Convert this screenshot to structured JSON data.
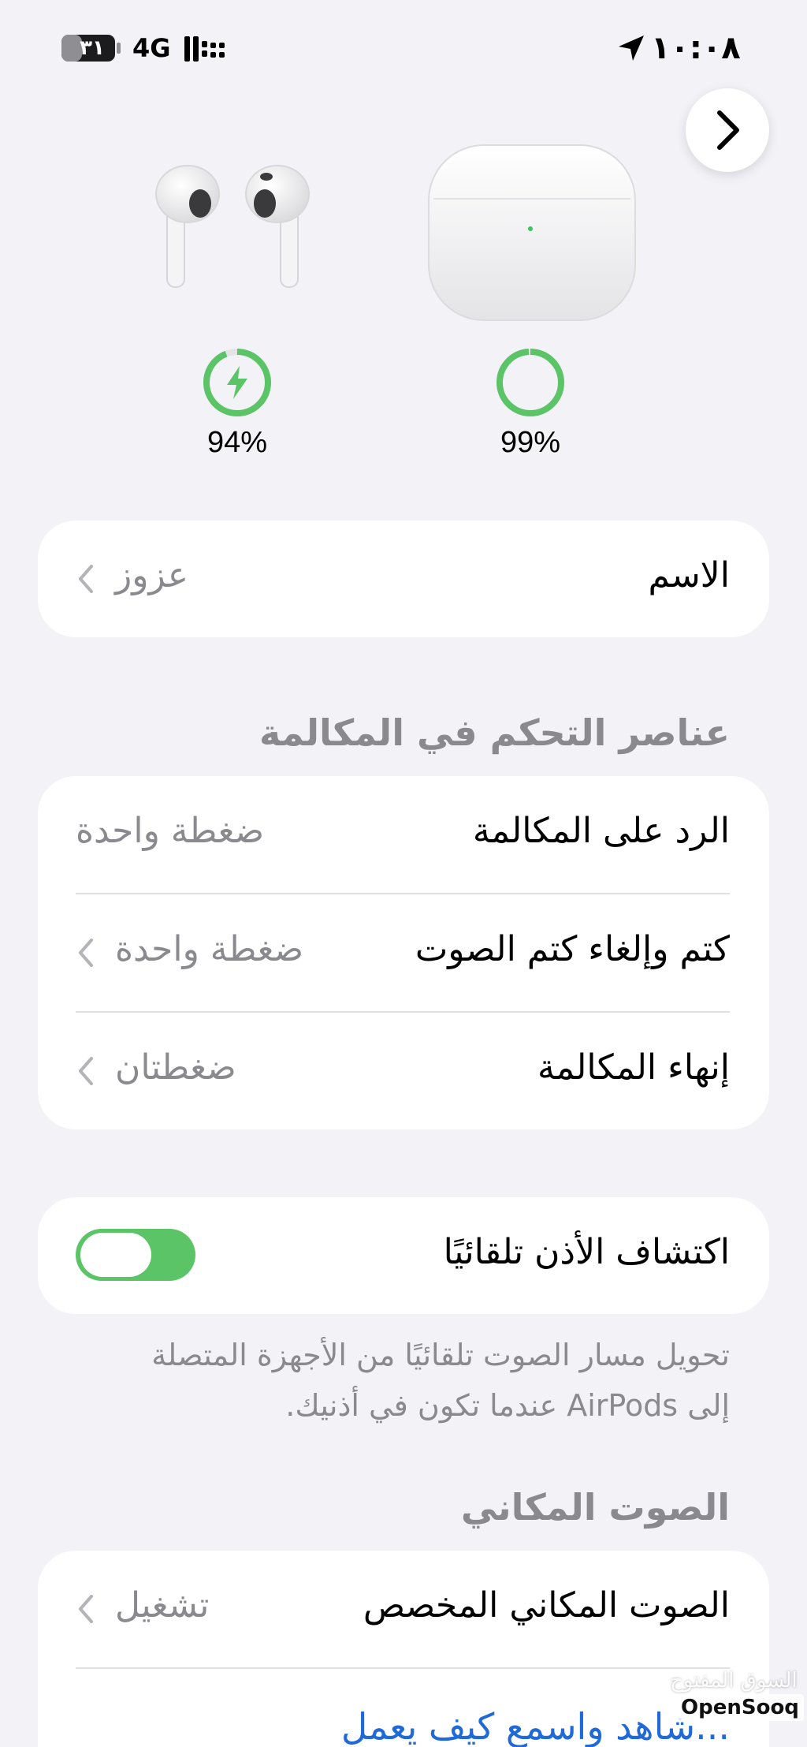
{
  "status_bar": {
    "time": "١٠:٠٨",
    "network": "4G",
    "battery": "٣١",
    "icons": [
      "location-arrow-icon",
      "signal-bars-icon",
      "battery-icon"
    ]
  },
  "header": {
    "next_icon": "chevron-right-icon"
  },
  "devices": {
    "earbuds": {
      "battery": "94%",
      "charging": true,
      "level": 0.94
    },
    "case": {
      "battery": "99%",
      "charging": false,
      "level": 0.99
    }
  },
  "name_row": {
    "label": "الاسم",
    "value": "عزوز"
  },
  "call_controls": {
    "header": "عناصر التحكم في المكالمة",
    "rows": [
      {
        "label": "الرد على المكالمة",
        "value": "ضغطة واحدة"
      },
      {
        "label": "كتم وإلغاء كتم الصوت",
        "value": "ضغطة واحدة"
      },
      {
        "label": "إنهاء المكالمة",
        "value": "ضغطتان"
      }
    ]
  },
  "ear_detection": {
    "label": "اكتشاف الأذن تلقائيًا",
    "enabled": true,
    "footnote_line1": "تحويل مسار الصوت تلقائيًا من الأجهزة المتصلة",
    "footnote_line2": "إلى AirPods عندما تكون في أذنيك."
  },
  "spatial_audio": {
    "header": "الصوت المكاني",
    "row": {
      "label": "الصوت المكاني المخصص",
      "value": "تشغيل"
    },
    "link": "شاهد واسمع كيف يعمل..."
  },
  "watermark": {
    "arabic": "السوق المفتوح",
    "latin": "OpenSooq"
  },
  "colors": {
    "accent_green": "#5bc466",
    "link_blue": "#1f6ad8",
    "background": "#f2f2f7"
  }
}
